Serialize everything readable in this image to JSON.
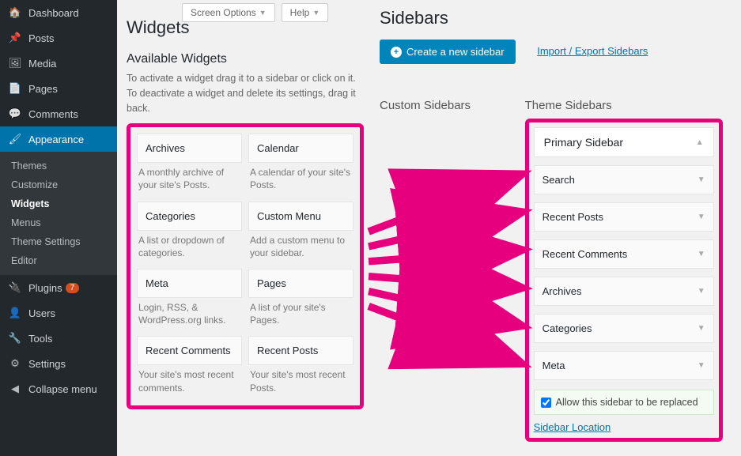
{
  "topButtons": {
    "screenOptions": "Screen Options",
    "help": "Help"
  },
  "adminMenu": [
    {
      "icon": "🏠",
      "label": "Dashboard"
    },
    {
      "icon": "📌",
      "label": "Posts"
    },
    {
      "icon": "🖼",
      "label": "Media"
    },
    {
      "icon": "📄",
      "label": "Pages"
    },
    {
      "icon": "💬",
      "label": "Comments"
    },
    {
      "icon": "🖌",
      "label": "Appearance",
      "current": true,
      "sub": [
        {
          "label": "Themes"
        },
        {
          "label": "Customize"
        },
        {
          "label": "Widgets",
          "active": true
        },
        {
          "label": "Menus"
        },
        {
          "label": "Theme Settings"
        },
        {
          "label": "Editor"
        }
      ]
    },
    {
      "icon": "🔌",
      "label": "Plugins",
      "badge": "7"
    },
    {
      "icon": "👤",
      "label": "Users"
    },
    {
      "icon": "🔧",
      "label": "Tools"
    },
    {
      "icon": "⚙",
      "label": "Settings"
    }
  ],
  "collapse": "Collapse menu",
  "page": {
    "title": "Widgets",
    "subtitle": "Available Widgets",
    "helpText": "To activate a widget drag it to a sidebar or click on it. To deactivate a widget and delete its settings, drag it back."
  },
  "availableWidgets": [
    {
      "name": "Archives",
      "desc": "A monthly archive of your site's Posts."
    },
    {
      "name": "Calendar",
      "desc": "A calendar of your site's Posts."
    },
    {
      "name": "Categories",
      "desc": "A list or dropdown of categories."
    },
    {
      "name": "Custom Menu",
      "desc": "Add a custom menu to your sidebar."
    },
    {
      "name": "Meta",
      "desc": "Login, RSS, & WordPress.org links."
    },
    {
      "name": "Pages",
      "desc": "A list of your site's Pages."
    },
    {
      "name": "Recent Comments",
      "desc": "Your site's most recent comments."
    },
    {
      "name": "Recent Posts",
      "desc": "Your site's most recent Posts."
    }
  ],
  "right": {
    "title": "Sidebars",
    "createLabel": "Create a new sidebar",
    "importExport": "Import / Export Sidebars",
    "customHeading": "Custom Sidebars",
    "themeHeading": "Theme Sidebars",
    "primary": {
      "title": "Primary Sidebar",
      "widgets": [
        "Search",
        "Recent Posts",
        "Recent Comments",
        "Archives",
        "Categories",
        "Meta"
      ],
      "allowReplace": "Allow this sidebar to be replaced",
      "allowChecked": true,
      "locationLink": "Sidebar Location"
    }
  }
}
